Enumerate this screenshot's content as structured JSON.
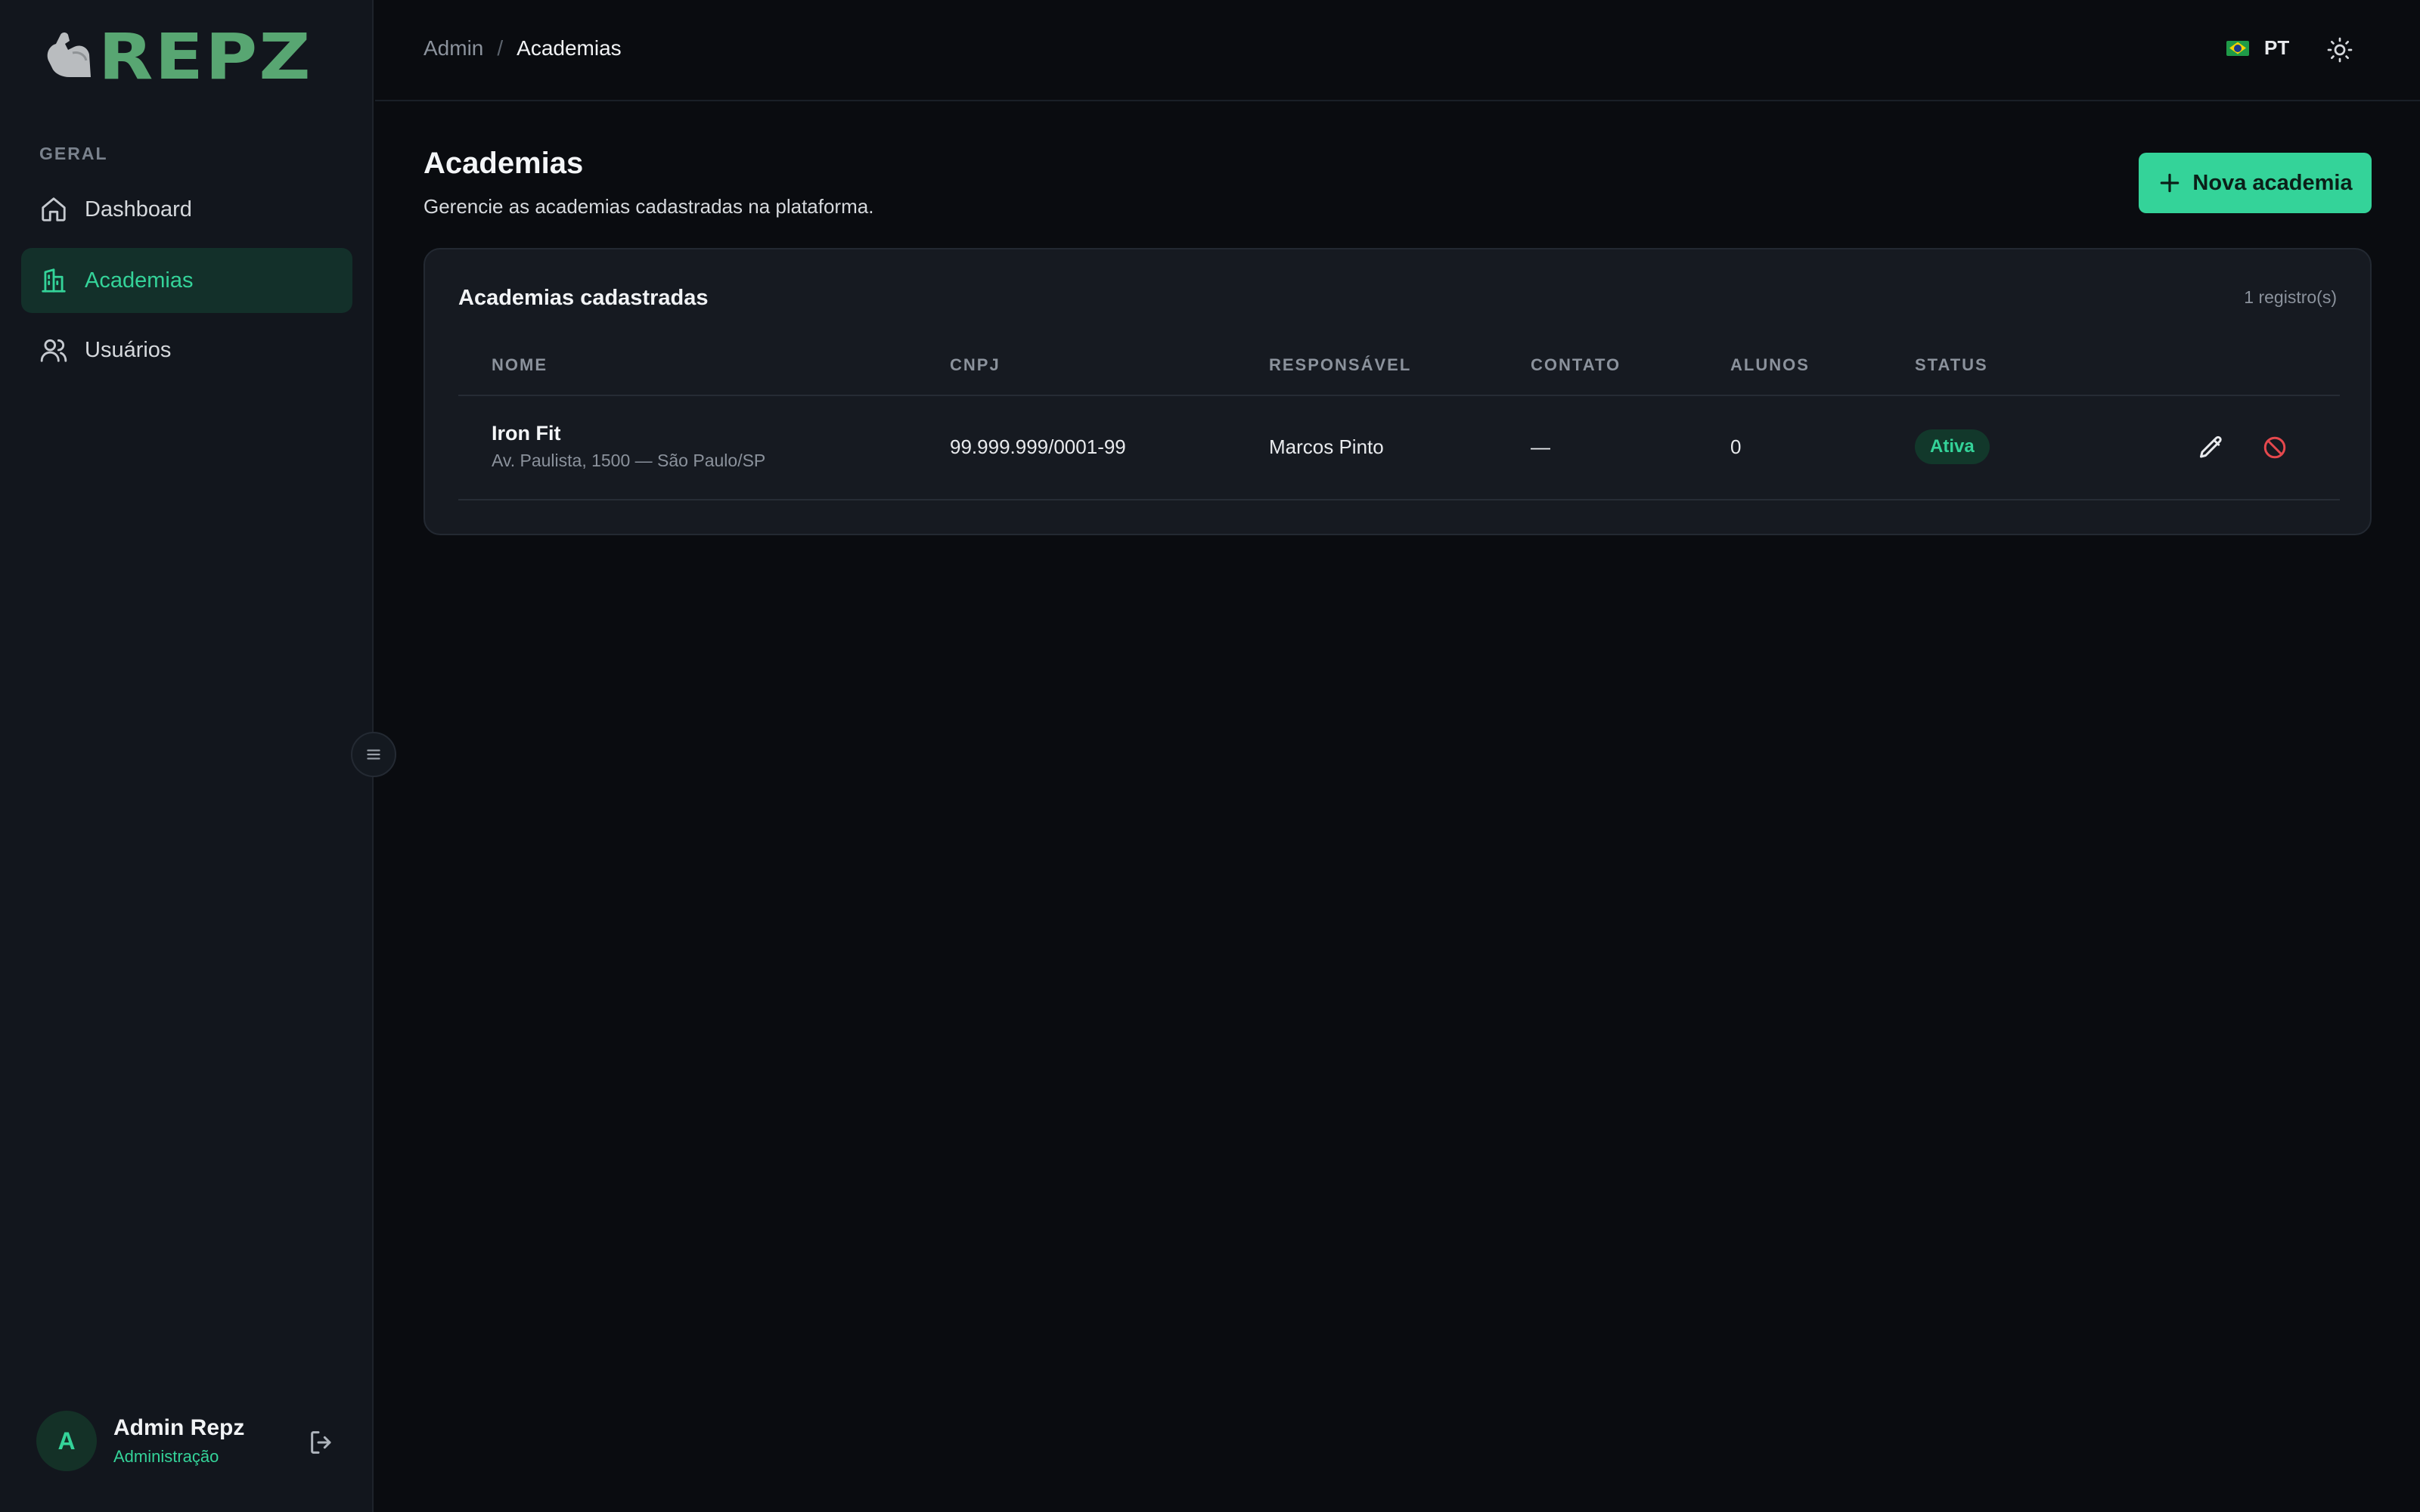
{
  "brand": {
    "name": "REPZ",
    "color": "#58a672"
  },
  "sidebar": {
    "section_label": "GERAL",
    "items": [
      {
        "label": "Dashboard",
        "icon": "home-icon",
        "active": false
      },
      {
        "label": "Academias",
        "icon": "building-icon",
        "active": true
      },
      {
        "label": "Usuários",
        "icon": "users-icon",
        "active": false
      }
    ]
  },
  "user": {
    "initial": "A",
    "name": "Admin Repz",
    "role": "Administração"
  },
  "breadcrumb": {
    "root": "Admin",
    "separator": "/",
    "current": "Academias"
  },
  "topbar": {
    "language": "PT"
  },
  "page": {
    "title": "Academias",
    "subtitle": "Gerencie as academias cadastradas na plataforma.",
    "new_button": "Nova academia"
  },
  "table": {
    "title": "Academias cadastradas",
    "count": "1 registro(s)",
    "columns": [
      "NOME",
      "CNPJ",
      "RESPONSÁVEL",
      "CONTATO",
      "ALUNOS",
      "STATUS"
    ],
    "rows": [
      {
        "name": "Iron Fit",
        "address": "Av. Paulista, 1500 — São Paulo/SP",
        "cnpj": "99.999.999/0001-99",
        "responsavel": "Marcos Pinto",
        "contato": "—",
        "alunos": "0",
        "status": "Ativa"
      }
    ]
  },
  "colors": {
    "accent": "#34d399",
    "danger": "#e5484d",
    "background": "#0a0c10",
    "sidebar": "#12161d"
  }
}
